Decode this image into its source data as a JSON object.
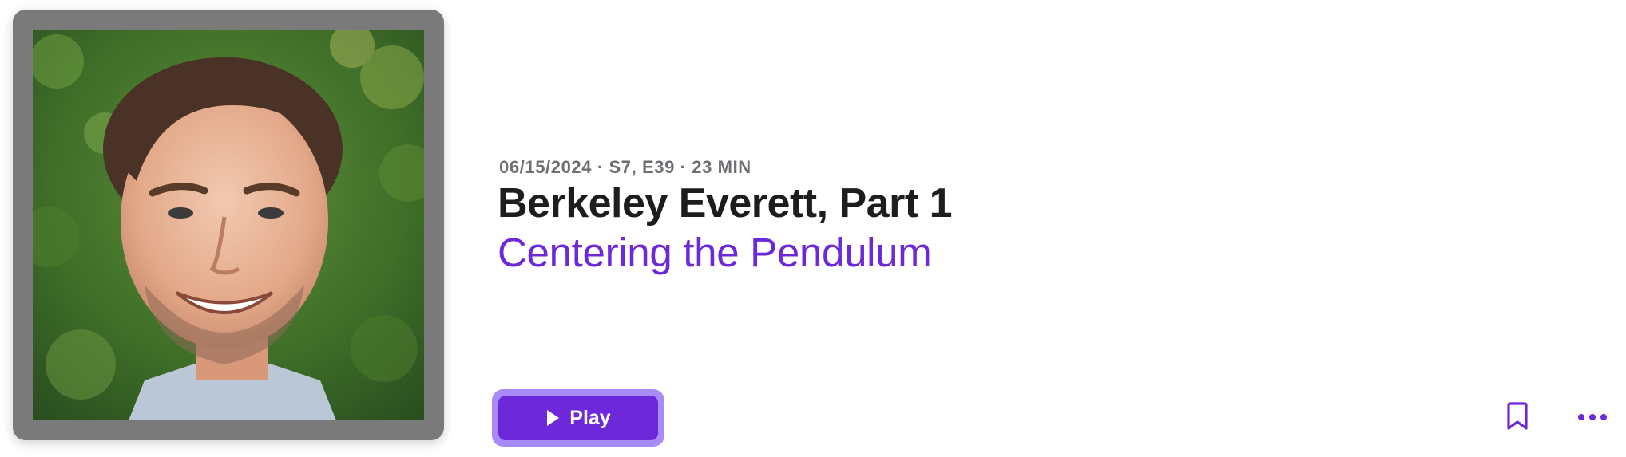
{
  "episode": {
    "meta": "06/15/2024 · S7, E39 · 23 MIN",
    "title": "Berkeley Everett, Part 1",
    "subtitle": "Centering the Pendulum"
  },
  "actions": {
    "play_label": "Play",
    "play_icon": "play-icon",
    "bookmark_icon": "bookmark-icon",
    "more_icon": "more-icon"
  },
  "colors": {
    "accent": "#6d28d9",
    "accent_ring": "#a78bfa",
    "title": "#1d1d1f",
    "meta": "#6e6e73",
    "artwork_frame": "#7a7a7a"
  }
}
